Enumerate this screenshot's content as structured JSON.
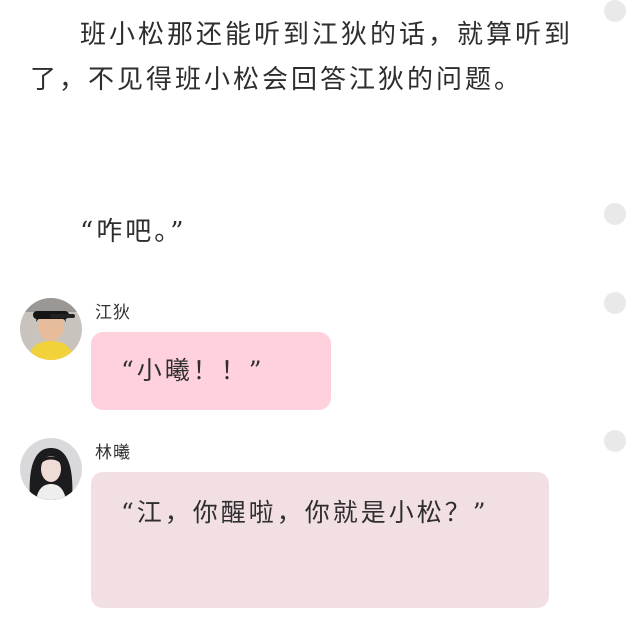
{
  "narration": {
    "para1": "班小松那还能听到江狄的话，就算听到了，不见得班小松会回答江狄的问题。",
    "para2": "“咋吧。”"
  },
  "messages": [
    {
      "sender": "江狄",
      "avatar": "boy-avatar",
      "text": "“小曦！！”",
      "bubble_color": "#ffd1dc"
    },
    {
      "sender": "林曦",
      "avatar": "girl-avatar",
      "text": "“江，你醒啦，你就是小松？”",
      "bubble_color": "#f2dfe3"
    }
  ],
  "colors": {
    "side_dot": "#e9e9e9",
    "text": "#2e2e2e",
    "background": "#ffffff"
  }
}
